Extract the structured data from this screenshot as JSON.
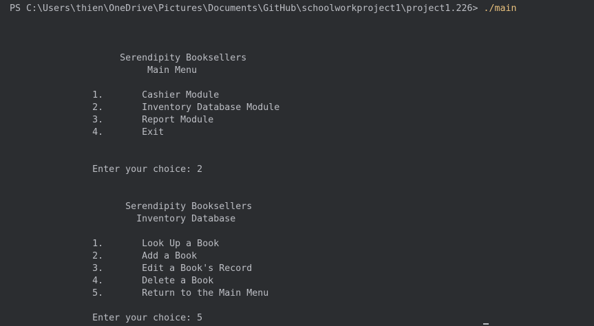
{
  "prompt": {
    "path": "PS C:\\Users\\thien\\OneDrive\\Pictures\\Documents\\GitHub\\schoolworkproject1\\project1.226> ",
    "command": "./main"
  },
  "output_lines": [
    "",
    "",
    "",
    "                    Serendipity Booksellers",
    "                         Main Menu",
    "",
    "               1.       Cashier Module",
    "               2.       Inventory Database Module",
    "               3.       Report Module",
    "               4.       Exit",
    "",
    "",
    "               Enter your choice: 2",
    "",
    "",
    "                     Serendipity Booksellers",
    "                       Inventory Database",
    "",
    "               1.       Look Up a Book",
    "               2.       Add a Book",
    "               3.       Edit a Book's Record",
    "               4.       Delete a Book",
    "               5.       Return to the Main Menu",
    "",
    "               Enter your choice: 5"
  ],
  "colors": {
    "background": "#2b2d30",
    "text": "#bcbec4",
    "command": "#e8c07d"
  }
}
